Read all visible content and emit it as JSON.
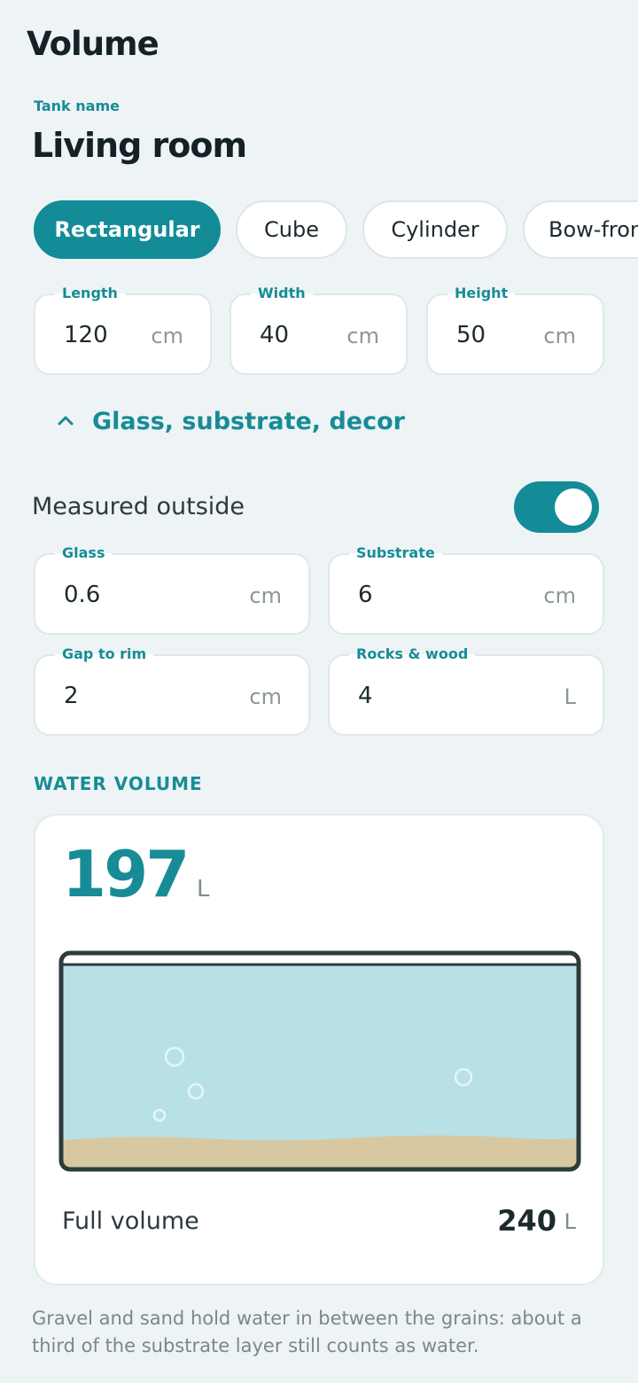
{
  "header": {
    "title": "Volume"
  },
  "tank": {
    "label": "Tank name",
    "name": "Living room"
  },
  "shapes": [
    {
      "label": "Rectangular",
      "selected": true
    },
    {
      "label": "Cube",
      "selected": false
    },
    {
      "label": "Cylinder",
      "selected": false
    },
    {
      "label": "Bow-front",
      "selected": false
    }
  ],
  "dimensions": {
    "length": {
      "label": "Length",
      "value": "120",
      "unit": "cm"
    },
    "width": {
      "label": "Width",
      "value": "40",
      "unit": "cm"
    },
    "height": {
      "label": "Height",
      "value": "50",
      "unit": "cm"
    }
  },
  "extras": {
    "expander_label": "Glass, substrate, decor",
    "expanded": true,
    "measured_outside": {
      "label": "Measured outside",
      "on": true
    },
    "glass": {
      "label": "Glass",
      "value": "0.6",
      "unit": "cm"
    },
    "substrate": {
      "label": "Substrate",
      "value": "6",
      "unit": "cm"
    },
    "gap": {
      "label": "Gap to rim",
      "value": "2",
      "unit": "cm"
    },
    "rocks": {
      "label": "Rocks & wood",
      "value": "4",
      "unit": "L"
    }
  },
  "result": {
    "section_label": "WATER VOLUME",
    "water_volume": "197",
    "water_unit": "L",
    "full_label": "Full volume",
    "full_volume": "240",
    "full_unit": "L"
  },
  "footnote": "Gravel and sand hold water in between the grains: about a third of the substrate layer still counts as water.",
  "colors": {
    "accent": "#138c98",
    "background": "#eef4f5",
    "water": "#b8e1e6",
    "sand": "#d8c8a2",
    "tank_frame": "#2c3b3c"
  },
  "icons": {
    "expander": "chevron-up-icon"
  }
}
